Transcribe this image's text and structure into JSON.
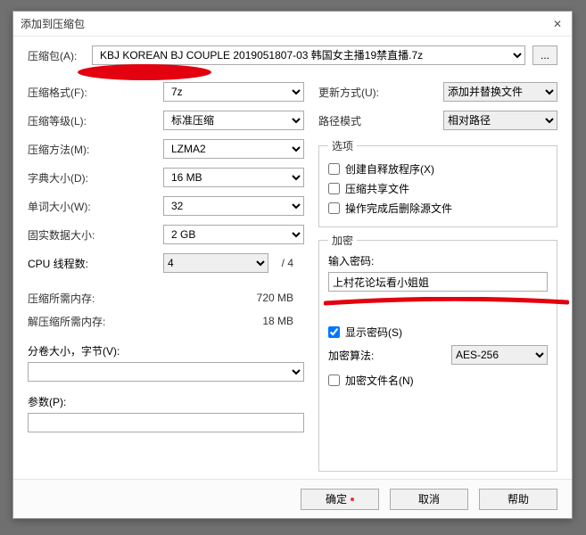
{
  "title": "添加到压缩包",
  "archive": {
    "label": "压缩包(A):",
    "value": "KBJ KOREAN BJ COUPLE 2019051807-03 韩国女主播19禁直播.7z",
    "browse": "..."
  },
  "left": {
    "format": {
      "label": "压缩格式(F):",
      "value": "7z"
    },
    "level": {
      "label": "压缩等级(L):",
      "value": "标准压缩"
    },
    "method": {
      "label": "压缩方法(M):",
      "value": "LZMA2"
    },
    "dict": {
      "label": "字典大小(D):",
      "value": "16 MB"
    },
    "word": {
      "label": "单词大小(W):",
      "value": "32"
    },
    "solid": {
      "label": "固实数据大小:",
      "value": "2 GB"
    },
    "cpu": {
      "label": "CPU 线程数:",
      "value": "4",
      "total": "/ 4"
    },
    "mem_comp": {
      "label": "压缩所需内存:",
      "value": "720 MB"
    },
    "mem_decomp": {
      "label": "解压缩所需内存:",
      "value": "18 MB"
    },
    "split": {
      "label": "分卷大小，字节(V):"
    },
    "params": {
      "label": "参数(P):"
    }
  },
  "right": {
    "update": {
      "label": "更新方式(U):",
      "value": "添加并替换文件"
    },
    "path": {
      "label": "路径模式",
      "value": "相对路径"
    },
    "options": {
      "legend": "选项",
      "sfx": "创建自释放程序(X)",
      "share": "压缩共享文件",
      "delete": "操作完成后删除源文件"
    },
    "encryption": {
      "legend": "加密",
      "pwd_label": "输入密码:",
      "pwd_value": "上村花论坛看小姐姐",
      "show": "显示密码(S)",
      "algo_label": "加密算法:",
      "algo_value": "AES-256",
      "names": "加密文件名(N)"
    }
  },
  "footer": {
    "ok": "确定",
    "cancel": "取消",
    "help": "帮助"
  }
}
